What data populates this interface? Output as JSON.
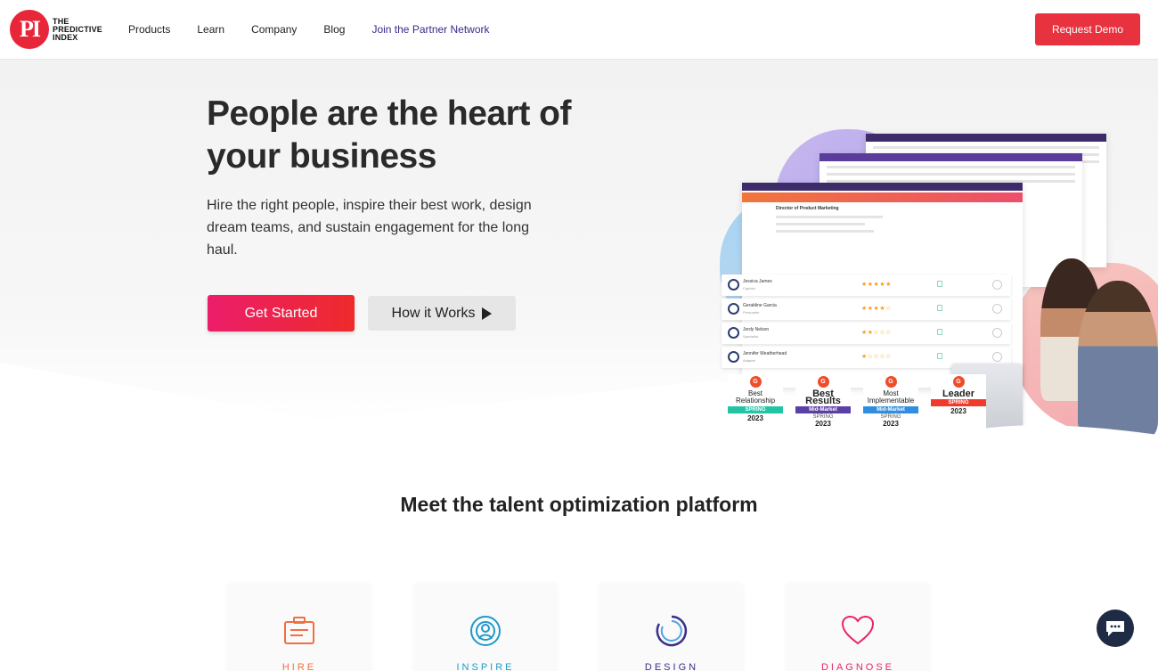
{
  "header": {
    "logo_mark": "PI",
    "logo_lines": [
      "THE",
      "PREDICTIVE",
      "INDEX"
    ],
    "nav": [
      {
        "label": "Products"
      },
      {
        "label": "Learn"
      },
      {
        "label": "Company"
      },
      {
        "label": "Blog"
      },
      {
        "label": "Join the Partner Network"
      }
    ],
    "cta_label": "Request Demo"
  },
  "hero": {
    "title": "People are the heart of your business",
    "subtitle": "Hire the right people, inspire their best work, design dream teams, and sustain engagement for the long haul.",
    "primary_button": "Get Started",
    "secondary_button": "How it Works"
  },
  "illustration": {
    "role_title": "Director of Product Marketing",
    "candidates": [
      {
        "name": "Jessica James",
        "role": "Captain",
        "stars": "★★★★★"
      },
      {
        "name": "Geraldine Garcia",
        "role": "Persuader",
        "stars": "★★★★☆"
      },
      {
        "name": "Jordy Nelson",
        "role": "Specialist",
        "stars": "★★☆☆☆"
      },
      {
        "name": "Jennifer Weatherhead",
        "role": "Adapter",
        "stars": "★☆☆☆☆"
      }
    ],
    "badges": [
      {
        "title": "Best Relationship",
        "ribbon": "SPRING",
        "ribbon_color": "#22c4a4",
        "season": "",
        "year": "2023"
      },
      {
        "title": "Best Results",
        "ribbon": "Mid-Market",
        "ribbon_color": "#5b3ea6",
        "season": "SPRING",
        "year": "2023"
      },
      {
        "title": "Most Implementable",
        "ribbon": "Mid-Market",
        "ribbon_color": "#2f8ee0",
        "season": "SPRING",
        "year": "2023"
      },
      {
        "title": "Leader",
        "ribbon": "SPRING",
        "ribbon_color": "#ef3b2c",
        "season": "",
        "year": "2023"
      }
    ],
    "g2_mark": "G"
  },
  "meet": {
    "prefix": "Meet the ",
    "emphasis": "talent optimization",
    "suffix": " platform"
  },
  "cards": [
    {
      "label": "HIRE",
      "color": "#f0703e",
      "icon": "briefcase-icon"
    },
    {
      "label": "INSPIRE",
      "color": "#1f9ac9",
      "icon": "person-target-icon"
    },
    {
      "label": "DESIGN",
      "color": "#3a2f8a",
      "icon": "ring-icon"
    },
    {
      "label": "DIAGNOSE",
      "color": "#e8236b",
      "icon": "heart-icon"
    }
  ],
  "colors": {
    "brand_red": "#e8263a",
    "demo_button": "#e8323f",
    "partner_link": "#3b2a8a"
  }
}
